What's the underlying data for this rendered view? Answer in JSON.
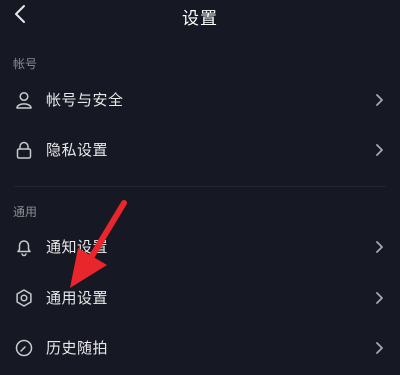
{
  "header": {
    "title": "设置",
    "back_icon": "chevron-left-icon"
  },
  "sections": [
    {
      "label": "帐号",
      "items": [
        {
          "label": "帐号与安全",
          "icon": "user-icon"
        },
        {
          "label": "隐私设置",
          "icon": "lock-icon"
        }
      ]
    },
    {
      "label": "通用",
      "items": [
        {
          "label": "通知设置",
          "icon": "bell-icon"
        },
        {
          "label": "通用设置",
          "icon": "gear-icon"
        },
        {
          "label": "历史随拍",
          "icon": "clock-icon"
        }
      ]
    }
  ],
  "colors": {
    "background": "#161823",
    "text": "#e8e8ea",
    "section_label": "#8a8b91",
    "annotation_arrow": "#e8262b"
  }
}
